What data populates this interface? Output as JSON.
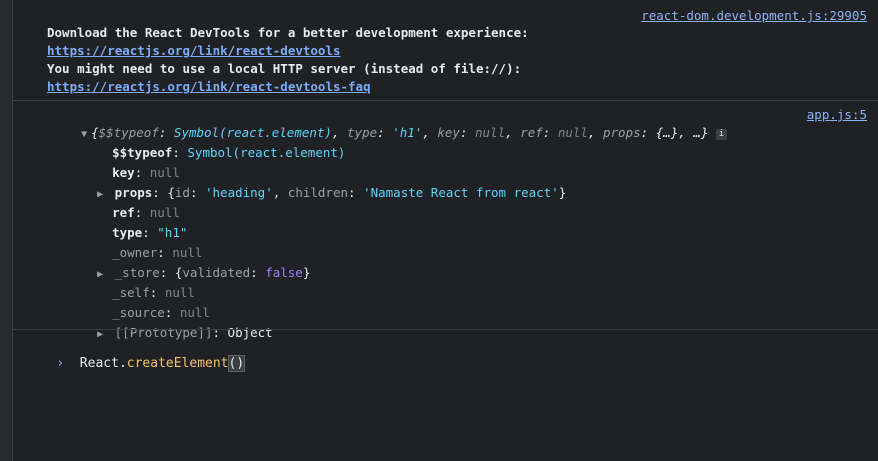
{
  "sources": {
    "devtools_msg": "react-dom.development.js:29905",
    "object_log": "app.js:5"
  },
  "message": {
    "line1": "Download the React DevTools for a better development experience:",
    "link1": "https://reactjs.org/link/react-devtools",
    "line2": "You might need to use a local HTTP server (instead of file://):",
    "link2": "https://reactjs.org/link/react-devtools-faq"
  },
  "object": {
    "summary": {
      "open": "{",
      "typeof_key": "$$typeof",
      "typeof_val": "Symbol(react.element)",
      "type_key": "type",
      "type_val": "'h1'",
      "key_key": "key",
      "key_val": "null",
      "ref_key": "ref",
      "ref_val": "null",
      "props_key": "props",
      "props_val": "{…}",
      "tail": ", …}",
      "info_icon": "i"
    },
    "props": [
      {
        "key": "$$typeof",
        "value": "Symbol(react.element)"
      },
      {
        "key": "key",
        "value": "null"
      },
      {
        "key": "props",
        "value_open": "{",
        "id_key": "id",
        "id_val": "'heading'",
        "children_key": "children",
        "children_val": "'Namaste React from react'",
        "value_close": "}"
      },
      {
        "key": "ref",
        "value": "null"
      },
      {
        "key": "type",
        "value": "\"h1\""
      },
      {
        "key": "_owner",
        "value": "null"
      },
      {
        "key": "_store",
        "value_open": "{",
        "validated_key": "validated",
        "validated_val": "false",
        "value_close": "}"
      },
      {
        "key": "_self",
        "value": "null"
      },
      {
        "key": "_source",
        "value": "null"
      },
      {
        "key": "[[Prototype]]",
        "value": "Object"
      }
    ]
  },
  "prompt": {
    "chevron": "›",
    "obj": "React",
    "dot": ".",
    "fn": "createElement",
    "paren_open": "(",
    "paren_close": ")"
  }
}
